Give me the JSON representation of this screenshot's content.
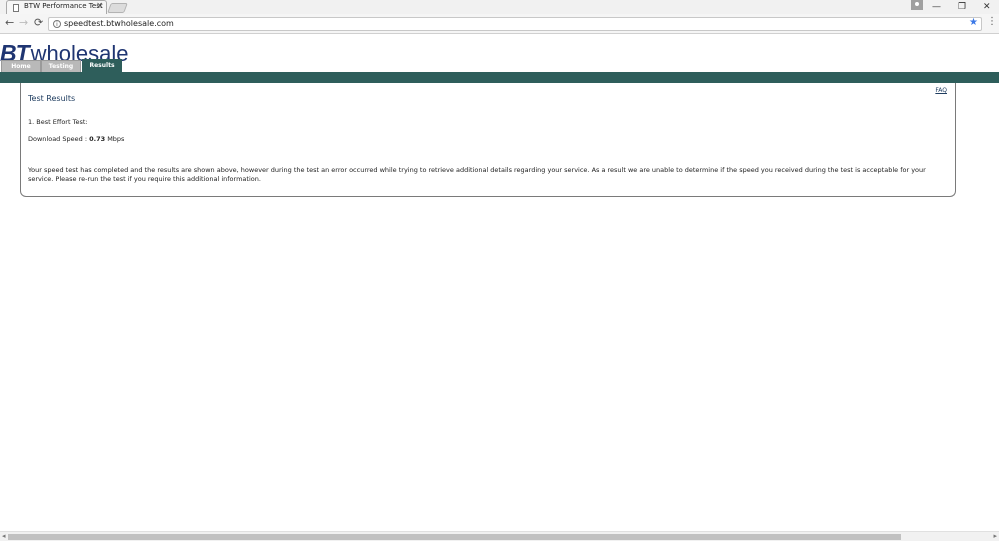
{
  "browser": {
    "tab_title": "BTW Performance Test",
    "tab_close": "×",
    "url": "speedtest.btwholesale.com",
    "icons": {
      "back": "←",
      "forward": "→",
      "reload": "⟳",
      "star": "★",
      "menu": "⋮",
      "minimize": "—",
      "restore": "❐",
      "close": "✕",
      "info": "i"
    }
  },
  "site": {
    "logo_bt": "BT",
    "logo_wholesale": "wholesale",
    "tabs": [
      {
        "label": "Home"
      },
      {
        "label": "Testing"
      },
      {
        "label": "Results"
      }
    ],
    "active_tab": "Results",
    "teal_color": "#2e5e5b",
    "brand_color": "#1f3572"
  },
  "results": {
    "title": "Test Results",
    "faq": "FAQ",
    "best_effort": "1. Best Effort Test:",
    "download_label": "Download Speed : ",
    "download_value": "0.73",
    "download_unit": " Mbps",
    "message": "Your speed test has completed and the results are shown above, however during the test an error occurred while trying to retrieve additional details regarding your service. As a result we are unable to determine if the speed you received during the test is acceptable for your service. Please re-run the test if you require this additional information."
  },
  "scrollbar": {
    "left": "◂",
    "right": "▸"
  }
}
